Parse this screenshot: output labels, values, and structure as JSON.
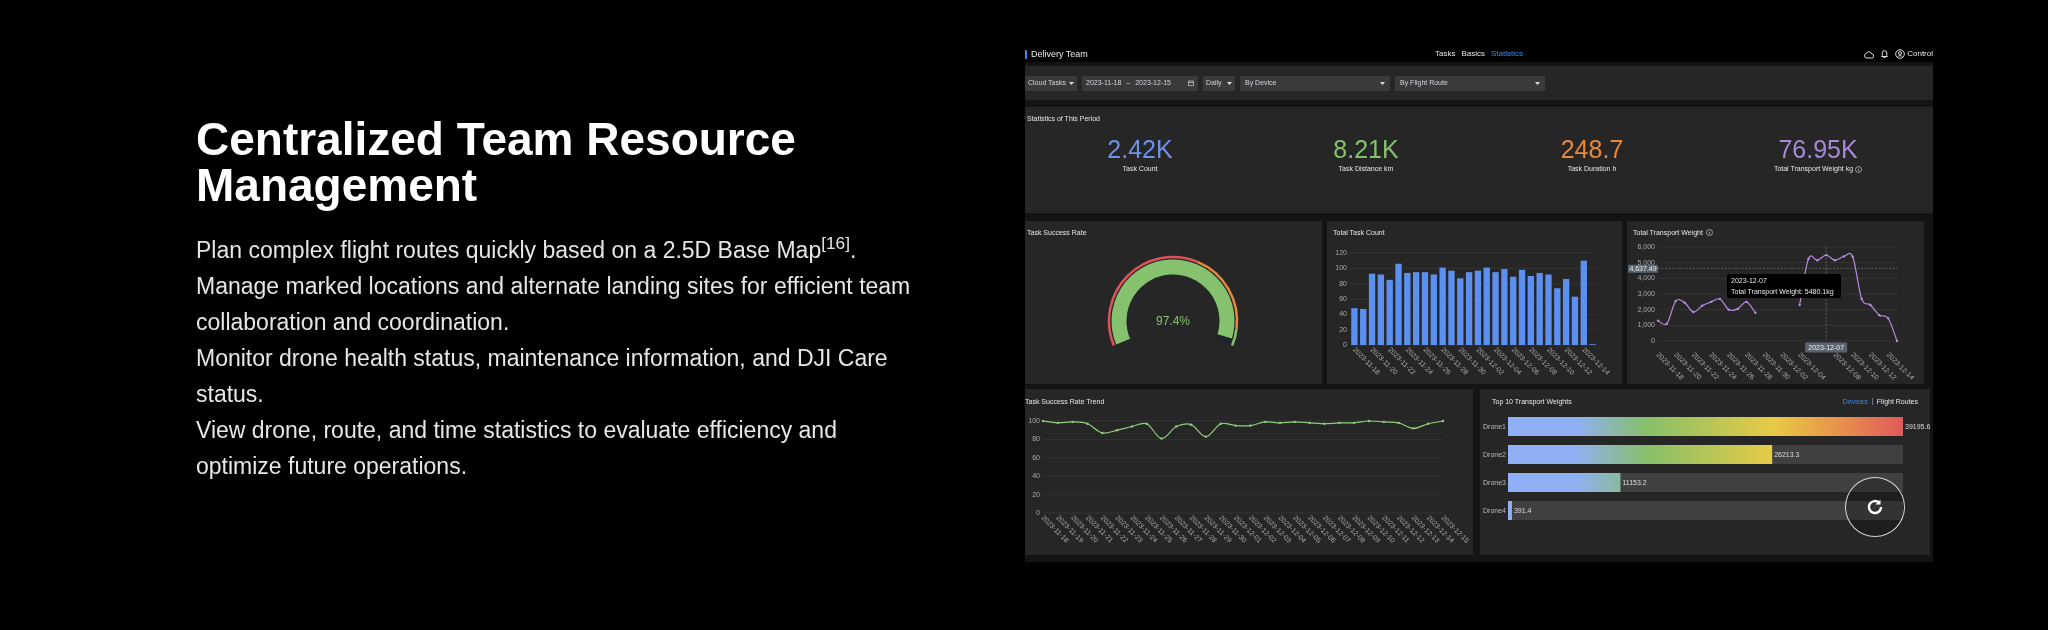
{
  "intro": {
    "heading": "Centralized Team Resource Management",
    "paragraphs": [
      "Plan complex flight routes quickly based on a 2.5D Base Map$^{[16]}$.",
      "Manage marked locations and alternate landing sites for efficient team collaboration and coordination.",
      "Monitor drone health status, maintenance information, and DJI Care status.",
      "View drone, route, and time statistics to evaluate efficiency and optimize future operations."
    ]
  },
  "dashboard": {
    "header": {
      "team": "Delivery Team",
      "tabs": [
        {
          "label": "Tasks",
          "selected": false
        },
        {
          "label": "Basics",
          "selected": false
        },
        {
          "label": "Statistics",
          "selected": true
        }
      ],
      "user": "Control"
    },
    "filters": {
      "task_type": "Cloud Tasks",
      "start_date": "2023-11-18",
      "separator": "–",
      "end_date": "2023-12-15",
      "interval": "Daily",
      "device": "By Device",
      "route": "By Flight Route"
    },
    "stats": {
      "title": "Statistics of This Period",
      "items": [
        {
          "value": "2.42K",
          "label": "Task Count",
          "color": "#6f93e8"
        },
        {
          "value": "8.21K",
          "label": "Task Distance km",
          "color": "#86c26e"
        },
        {
          "value": "248.7",
          "label": "Task Duration h",
          "color": "#e8883c"
        },
        {
          "value": "76.95K",
          "label": "Total Transport Weight kg",
          "color": "#a88ad8",
          "info": true
        }
      ]
    },
    "success_rate": {
      "title": "Task Success Rate",
      "value": "97.4%"
    },
    "task_count": {
      "title": "Total Task Count",
      "chart_data": {
        "type": "bar",
        "grid": true,
        "categories": [
          "2023-11-18",
          null,
          "2023-11-20",
          null,
          "2023-11-22",
          null,
          "2023-11-24",
          null,
          "2023-11-26",
          null,
          "2023-11-28",
          null,
          "2023-11-30",
          null,
          "2023-12-02",
          null,
          "2023-12-04",
          null,
          "2023-12-06",
          null,
          "2023-12-08",
          null,
          "2023-12-10",
          null,
          "2023-12-12",
          null,
          "2023-12-14",
          null
        ],
        "series": [
          {
            "color": "#5b8ff0",
            "values": [
              48,
              47,
              93,
              92,
              85,
              106,
              94,
              95,
              95,
              92,
              101,
              97,
              87,
              95,
              97,
              101,
              95,
              99,
              89,
              98,
              90,
              94,
              92,
              74,
              86,
              63,
              110,
              1
            ]
          }
        ],
        "ylim": [
          0,
          120
        ],
        "yticks": [
          0,
          20,
          40,
          60,
          80,
          100,
          120
        ]
      }
    },
    "transport_weight": {
      "title": "Total Transport Weight",
      "info": true,
      "chart_data": {
        "type": "line",
        "grid": true,
        "categories": [
          "2023-11-18",
          null,
          "2023-11-20",
          null,
          "2023-11-22",
          null,
          "2023-11-24",
          null,
          "2023-11-26",
          null,
          "2023-11-28",
          null,
          "2023-11-30",
          null,
          "2023-12-02",
          null,
          "2023-12-04",
          null,
          null,
          null,
          "2023-12-08",
          null,
          "2023-12-10",
          null,
          "2023-12-12",
          null,
          "2023-12-14",
          null
        ],
        "series": [
          {
            "color": "#b78be0",
            "values": [
              1300,
              1100,
              2550,
              2450,
              1850,
              2250,
              2500,
              2680,
              2000,
              2050,
              2500,
              1800,
              null,
              null,
              null,
              null,
              2300,
              5250,
              5150,
              5480,
              5150,
              5400,
              5380,
              2700,
              2300,
              1650,
              1450,
              0
            ]
          }
        ],
        "ylim": [
          0,
          6000
        ],
        "yticks": [
          {
            "value": 0,
            "label": "0"
          },
          {
            "value": 1000,
            "label": "1,000"
          },
          {
            "value": 2000,
            "label": "2,000"
          },
          {
            "value": 3000,
            "label": "3,000"
          },
          {
            "value": 4000,
            "label": "4,000"
          },
          {
            "value": 5000,
            "label": "5,000"
          },
          {
            "value": 6000,
            "label": "6,000"
          }
        ]
      },
      "pointer": {
        "y_label": "4,637.49",
        "x_label": "2023-12-07"
      },
      "tooltip": {
        "date": "2023-12-07",
        "text": "Total Transport Weight: 5480.1kg"
      }
    },
    "trend": {
      "title": "Task Success Rate Trend",
      "chart_data": {
        "type": "line",
        "grid": true,
        "categories": [
          "2023-11-18",
          "2023-11-19",
          "2023-11-20",
          "2023-11-21",
          "2023-11-22",
          "2023-11-23",
          "2023-11-24",
          "2023-11-25",
          "2023-11-26",
          "2023-11-27",
          "2023-11-28",
          "2023-11-29",
          "2023-11-30",
          "2023-12-01",
          "2023-12-02",
          "2023-12-03",
          "2023-12-04",
          "2023-12-05",
          "2023-12-06",
          "2023-12-07",
          "2023-12-08",
          "2023-12-09",
          "2023-12-10",
          "2023-12-11",
          "2023-12-12",
          "2023-12-13",
          "2023-12-14",
          "2023-12-15"
        ],
        "series": [
          {
            "color": "#8fcf7a",
            "values": [
              100,
              98,
              99,
              97,
              87,
              90,
              94,
              97,
              81,
              94,
              96,
              83,
              97,
              95,
              95,
              99,
              98,
              99,
              98,
              97,
              98,
              98,
              100,
              99,
              98,
              92,
              97,
              100
            ]
          }
        ],
        "ylim": [
          0,
          100
        ],
        "yticks": [
          0,
          20,
          40,
          60,
          80,
          100
        ]
      }
    },
    "top_weights": {
      "title": "Top 10 Transport Weights",
      "toggle": [
        {
          "label": "Devices",
          "selected": true
        },
        {
          "label": "Flight Routes",
          "selected": false
        }
      ],
      "chart_data": {
        "type": "bar",
        "orientation": "horizontal",
        "categories": [
          "Drone1",
          "Drone2",
          "Drone3",
          "Drone4"
        ],
        "values": [
          39195.6,
          26213.3,
          11153.2,
          391.4
        ],
        "value_labels": [
          "39195.6",
          "26213.3",
          "11153.2",
          "391.4"
        ]
      }
    }
  }
}
